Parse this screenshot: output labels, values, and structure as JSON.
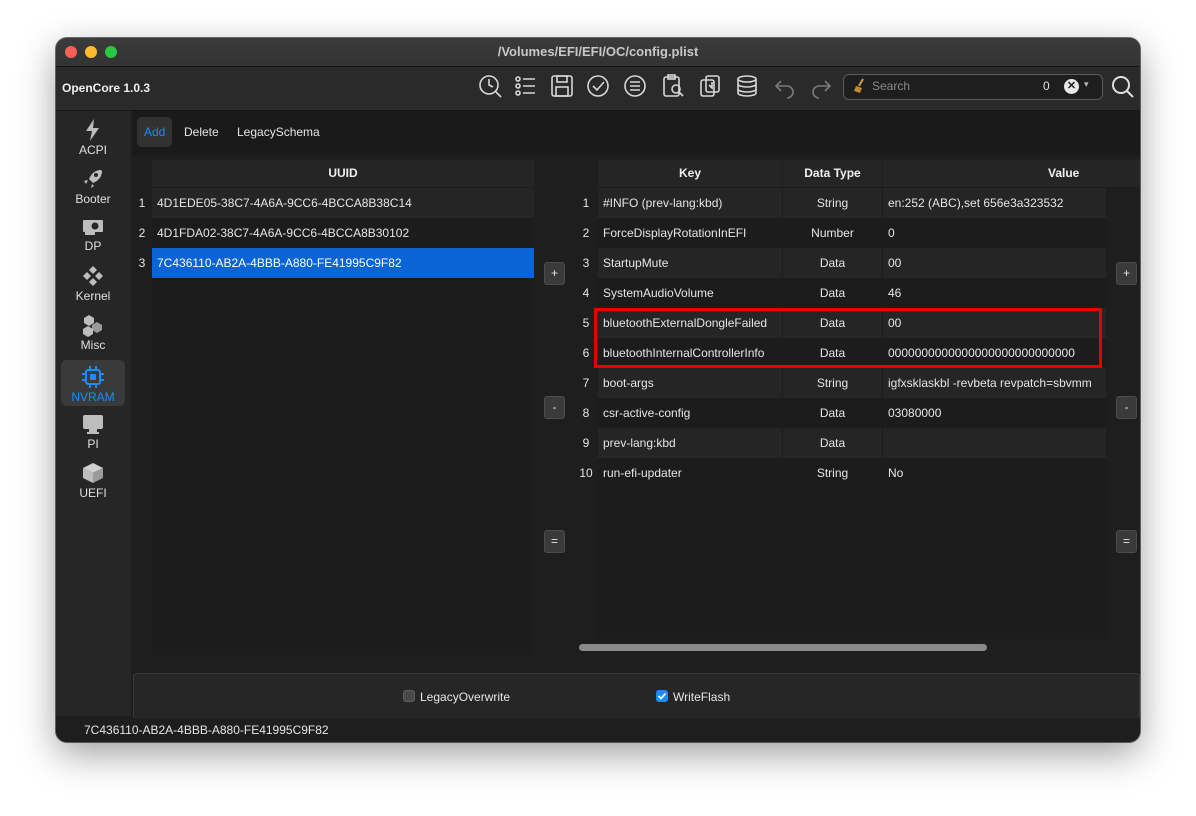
{
  "window": {
    "title": "/Volumes/EFI/EFI/OC/config.plist"
  },
  "toolbar": {
    "app_name": "OpenCore 1.0.3",
    "icons": [
      "clock-search-icon",
      "list-icon",
      "save-icon",
      "checkmark-circle-icon",
      "list-circle-icon",
      "clipboard-search-icon",
      "paste-icon",
      "database-icon",
      "undo-icon",
      "redo-icon"
    ],
    "search": {
      "placeholder": "Search",
      "count": "0",
      "clear_glyph": "✕",
      "drop_glyph": "▾"
    }
  },
  "sidebar": {
    "items": [
      {
        "label": "ACPI",
        "icon": "lightning-icon"
      },
      {
        "label": "Booter",
        "icon": "rocket-icon"
      },
      {
        "label": "DP",
        "icon": "gpu-card-icon"
      },
      {
        "label": "Kernel",
        "icon": "gears-icon"
      },
      {
        "label": "Misc",
        "icon": "cubes-icon"
      },
      {
        "label": "NVRAM",
        "icon": "chip-icon",
        "active": true
      },
      {
        "label": "PI",
        "icon": "display-icon"
      },
      {
        "label": "UEFI",
        "icon": "box-icon"
      }
    ]
  },
  "subtabs": {
    "add": "Add",
    "delete": "Delete",
    "legacy_schema": "LegacySchema"
  },
  "uuid_table": {
    "header": "UUID",
    "rows": [
      {
        "n": "1",
        "uuid": "4D1EDE05-38C7-4A6A-9CC6-4BCCA8B38C14"
      },
      {
        "n": "2",
        "uuid": "4D1FDA02-38C7-4A6A-9CC6-4BCCA8B30102"
      },
      {
        "n": "3",
        "uuid": "7C436110-AB2A-4BBB-A880-FE41995C9F82",
        "selected": true
      }
    ]
  },
  "key_table": {
    "headers": {
      "key": "Key",
      "type": "Data Type",
      "value": "Value"
    },
    "rows": [
      {
        "n": "1",
        "key": "#INFO (prev-lang:kbd)",
        "type": "String",
        "value": "en:252 (ABC),set 656e3a323532"
      },
      {
        "n": "2",
        "key": "ForceDisplayRotationInEFI",
        "type": "Number",
        "value": "0"
      },
      {
        "n": "3",
        "key": "StartupMute",
        "type": "Data",
        "value": "00"
      },
      {
        "n": "4",
        "key": "SystemAudioVolume",
        "type": "Data",
        "value": "46"
      },
      {
        "n": "5",
        "key": "bluetoothExternalDongleFailed",
        "type": "Data",
        "value": "00"
      },
      {
        "n": "6",
        "key": "bluetoothInternalControllerInfo",
        "type": "Data",
        "value": "0000000000000000000000000000"
      },
      {
        "n": "7",
        "key": "boot-args",
        "type": "String",
        "value": "igfxsklaskbl -revbeta revpatch=sbvmm"
      },
      {
        "n": "8",
        "key": "csr-active-config",
        "type": "Data",
        "value": "03080000"
      },
      {
        "n": "9",
        "key": "prev-lang:kbd",
        "type": "Data",
        "value": ""
      },
      {
        "n": "10",
        "key": "run-efi-updater",
        "type": "String",
        "value": "No"
      }
    ]
  },
  "side_buttons": {
    "add": "+",
    "remove": "-",
    "copy": "="
  },
  "options": {
    "legacy_overwrite": {
      "label": "LegacyOverwrite",
      "checked": false
    },
    "write_flash": {
      "label": "WriteFlash",
      "checked": true
    }
  },
  "status_bar": {
    "text": "7C436110-AB2A-4BBB-A880-FE41995C9F82"
  },
  "colors": {
    "accent": "#1a8cff",
    "selection": "#0a64d6",
    "highlight_box": "#e60000",
    "background": "#1e1e1e"
  }
}
